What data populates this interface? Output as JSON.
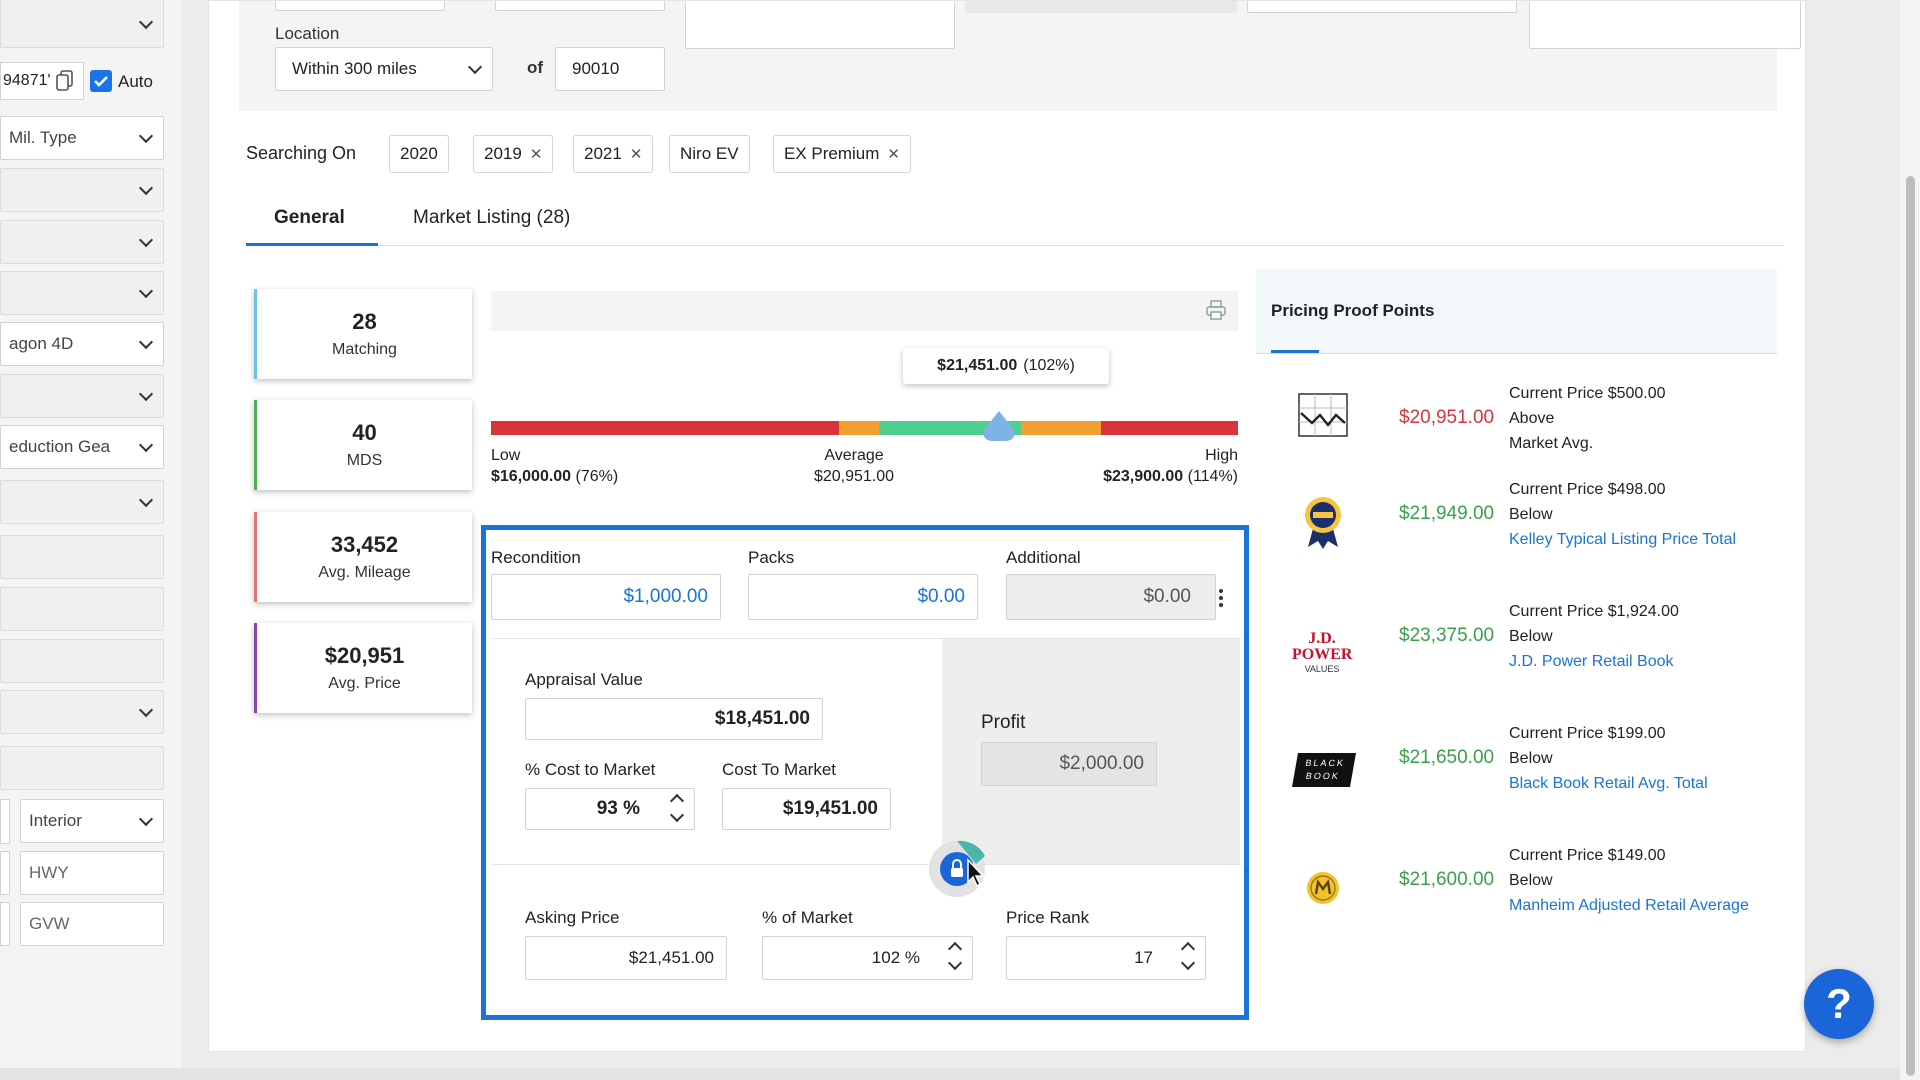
{
  "sidebar": {
    "vin_fragment": "94871'",
    "auto_label": "Auto",
    "mil_type": "Mil. Type",
    "body_type": "agon 4D",
    "transmission": "eduction Gea",
    "interior_label": "Interior",
    "hwy_placeholder": "HWY",
    "gvw_placeholder": "GVW"
  },
  "filters": {
    "location_label": "Location",
    "location_value": "Within 300 miles",
    "of_label": "of",
    "zip": "90010"
  },
  "searching": {
    "label": "Searching On",
    "chips": [
      {
        "label": "2020",
        "removable": false
      },
      {
        "label": "2019",
        "removable": true
      },
      {
        "label": "2021",
        "removable": true
      },
      {
        "label": "Niro EV",
        "removable": false
      },
      {
        "label": "EX Premium",
        "removable": true
      }
    ]
  },
  "tabs": {
    "general": "General",
    "market": "Market Listing (28)"
  },
  "stats": [
    {
      "value": "28",
      "label": "Matching",
      "color": "#6ec1ea"
    },
    {
      "value": "40",
      "label": "MDS",
      "color": "#4caf50"
    },
    {
      "value": "33,452",
      "label": "Avg. Mileage",
      "color": "#e57373"
    },
    {
      "value": "$20,951",
      "label": "Avg. Price",
      "color": "#8e44ad"
    }
  ],
  "gauge": {
    "tooltip_price": "$21,451.00",
    "tooltip_pct": "(102%)",
    "marker_fraction": 0.68,
    "low_label": "Low",
    "low_value": "$16,000.00",
    "low_pct": "(76%)",
    "avg_label": "Average",
    "avg_value": "$20,951.00",
    "high_label": "High",
    "high_value": "$23,900.00",
    "high_pct": "(114%)"
  },
  "costs": {
    "recondition_label": "Recondition",
    "recondition_value": "$1,000.00",
    "packs_label": "Packs",
    "packs_value": "$0.00",
    "additional_label": "Additional",
    "additional_value": "$0.00"
  },
  "appraisal": {
    "label": "Appraisal Value",
    "value": "$18,451.00",
    "pct_cost_label": "% Cost to Market",
    "pct_cost_value": "93 %",
    "cost_label": "Cost To Market",
    "cost_value": "$19,451.00",
    "profit_label": "Profit",
    "profit_value": "$2,000.00"
  },
  "asking": {
    "label": "Asking Price",
    "value": "$21,451.00",
    "pct_label": "% of Market",
    "pct_value": "102 %",
    "rank_label": "Price Rank",
    "rank_value": "17"
  },
  "proof": {
    "title": "Pricing Proof Points",
    "items": [
      {
        "source": "market-chart",
        "price": "$20,951.00",
        "price_color": "#d9343b",
        "line1": "Current Price $500.00",
        "line2": "Above",
        "line3": "Market Avg.",
        "link": ""
      },
      {
        "source": "kbb",
        "price": "$21,949.00",
        "price_color": "#3aa14a",
        "line1": "Current Price $498.00",
        "line2": "Below",
        "line3": "",
        "link": "Kelley Typical Listing Price Total"
      },
      {
        "source": "jdpower",
        "price": "$23,375.00",
        "price_color": "#3aa14a",
        "line1": "Current Price $1,924.00",
        "line2": "Below",
        "line3": "",
        "link": "J.D. Power Retail Book"
      },
      {
        "source": "blackbook",
        "price": "$21,650.00",
        "price_color": "#3aa14a",
        "line1": "Current Price $199.00",
        "line2": "Below",
        "line3": "",
        "link": "Black Book Retail Avg. Total"
      },
      {
        "source": "manheim",
        "price": "$21,600.00",
        "price_color": "#3aa14a",
        "line1": "Current Price $149.00",
        "line2": "Below",
        "line3": "",
        "link": "Manheim Adjusted Retail Average"
      }
    ],
    "jd_logo_top": "J.D. POWER",
    "jd_logo_bottom": "VALUES",
    "bb_logo_top": "BLACK",
    "bb_logo_bottom": "BOOK"
  },
  "help_label": "?"
}
